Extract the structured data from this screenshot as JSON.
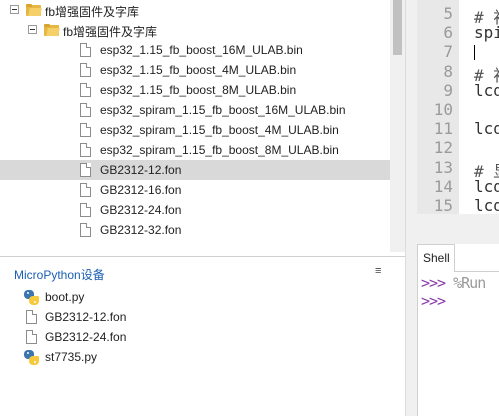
{
  "file_tree": {
    "items": [
      {
        "label": "fb增强固件及字库",
        "type": "folder",
        "level": 0,
        "expanded": true
      },
      {
        "label": "fb增强固件及字库",
        "type": "folder",
        "level": 1,
        "expanded": true
      },
      {
        "label": "esp32_1.15_fb_boost_16M_ULAB.bin",
        "type": "file",
        "level": 2
      },
      {
        "label": "esp32_1.15_fb_boost_4M_ULAB.bin",
        "type": "file",
        "level": 2
      },
      {
        "label": "esp32_1.15_fb_boost_8M_ULAB.bin",
        "type": "file",
        "level": 2
      },
      {
        "label": "esp32_spiram_1.15_fb_boost_16M_ULAB.bin",
        "type": "file",
        "level": 2
      },
      {
        "label": "esp32_spiram_1.15_fb_boost_4M_ULAB.bin",
        "type": "file",
        "level": 2
      },
      {
        "label": "esp32_spiram_1.15_fb_boost_8M_ULAB.bin",
        "type": "file",
        "level": 2
      },
      {
        "label": "GB2312-12.fon",
        "type": "file",
        "level": 2,
        "selected": true
      },
      {
        "label": "GB2312-16.fon",
        "type": "file",
        "level": 2
      },
      {
        "label": "GB2312-24.fon",
        "type": "file",
        "level": 2
      },
      {
        "label": "GB2312-32.fon",
        "type": "file",
        "level": 2
      }
    ]
  },
  "device_panel": {
    "title": "MicroPython设备",
    "menu_icon": "≡",
    "items": [
      {
        "label": "boot.py",
        "icon": "python-file-icon"
      },
      {
        "label": "GB2312-12.fon",
        "icon": "file-icon"
      },
      {
        "label": "GB2312-24.fon",
        "icon": "file-icon"
      },
      {
        "label": "st7735.py",
        "icon": "python-file-icon"
      }
    ]
  },
  "editor": {
    "line_numbers": [
      "5",
      "6",
      "7",
      "8",
      "9",
      "10",
      "11",
      "12",
      "13",
      "14",
      "15"
    ],
    "code_lines": [
      "# 初",
      "spi",
      "",
      "# 初",
      "lcd",
      "",
      "lcd",
      "",
      "# 显",
      "lcd",
      "lcd"
    ]
  },
  "shell": {
    "tab_label": "Shell",
    "prompts": [
      ">>>",
      ">>>"
    ],
    "first_prompt_text": "%Run"
  },
  "colors": {
    "selection": "#d9d9d9",
    "device_title": "#1a5fb4",
    "prompt": "#8a3ca8",
    "folder": "#e6b743"
  }
}
